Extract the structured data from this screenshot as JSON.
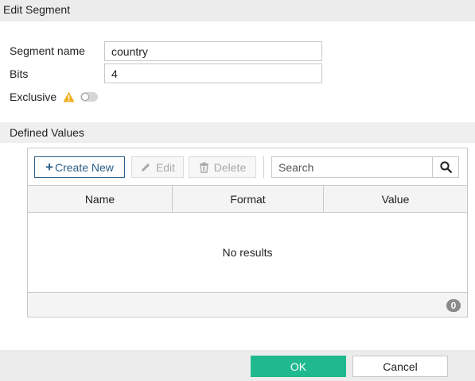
{
  "dialog": {
    "title": "Edit Segment"
  },
  "form": {
    "segment_name": {
      "label": "Segment name",
      "value": "country"
    },
    "bits": {
      "label": "Bits",
      "value": "4"
    },
    "exclusive": {
      "label": "Exclusive",
      "enabled": false,
      "warning_icon": "warning-triangle-icon"
    }
  },
  "defined_values": {
    "section_title": "Defined Values",
    "toolbar": {
      "create_new": "Create New",
      "edit": "Edit",
      "delete": "Delete",
      "search_placeholder": "Search"
    },
    "table": {
      "columns": [
        "Name",
        "Format",
        "Value"
      ],
      "rows": [],
      "empty_message": "No results",
      "count": "0"
    }
  },
  "footer": {
    "ok_label": "OK",
    "cancel_label": "Cancel"
  },
  "colors": {
    "accent": "#20b98f",
    "primary_border": "#2b5e88",
    "warning": "#f0ad1e",
    "header_bg": "#ececec"
  }
}
